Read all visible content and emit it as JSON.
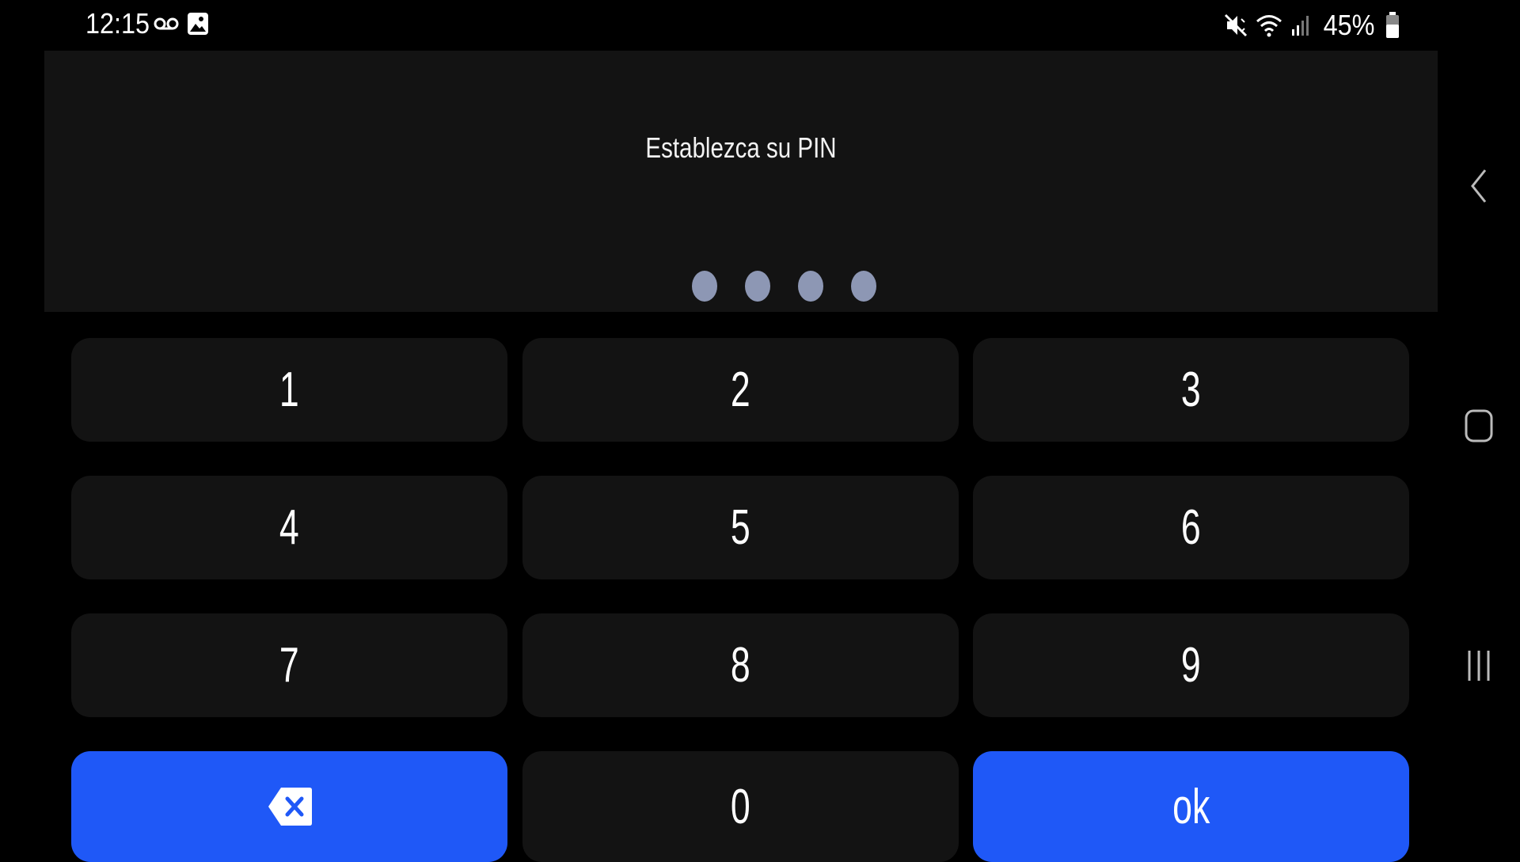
{
  "status_bar": {
    "time": "12:15",
    "battery_percent": "45%",
    "icons": [
      "voicemail-icon",
      "image-notification-icon",
      "vibrate-mute-icon",
      "wifi-icon",
      "signal-icon",
      "battery-icon"
    ]
  },
  "pin_entry": {
    "title": "Establezca su PIN",
    "entered_digits": 4
  },
  "keypad": {
    "keys": [
      "1",
      "2",
      "3",
      "4",
      "5",
      "6",
      "7",
      "8",
      "9",
      "0"
    ],
    "ok_label": "ok",
    "backspace_icon": "backspace-icon"
  },
  "nav_bar": {
    "icons": [
      "back-icon",
      "home-icon",
      "recents-icon"
    ]
  },
  "colors": {
    "background": "#000000",
    "panel": "#131313",
    "accent": "#1f58f7",
    "dot": "#8d97b4"
  }
}
